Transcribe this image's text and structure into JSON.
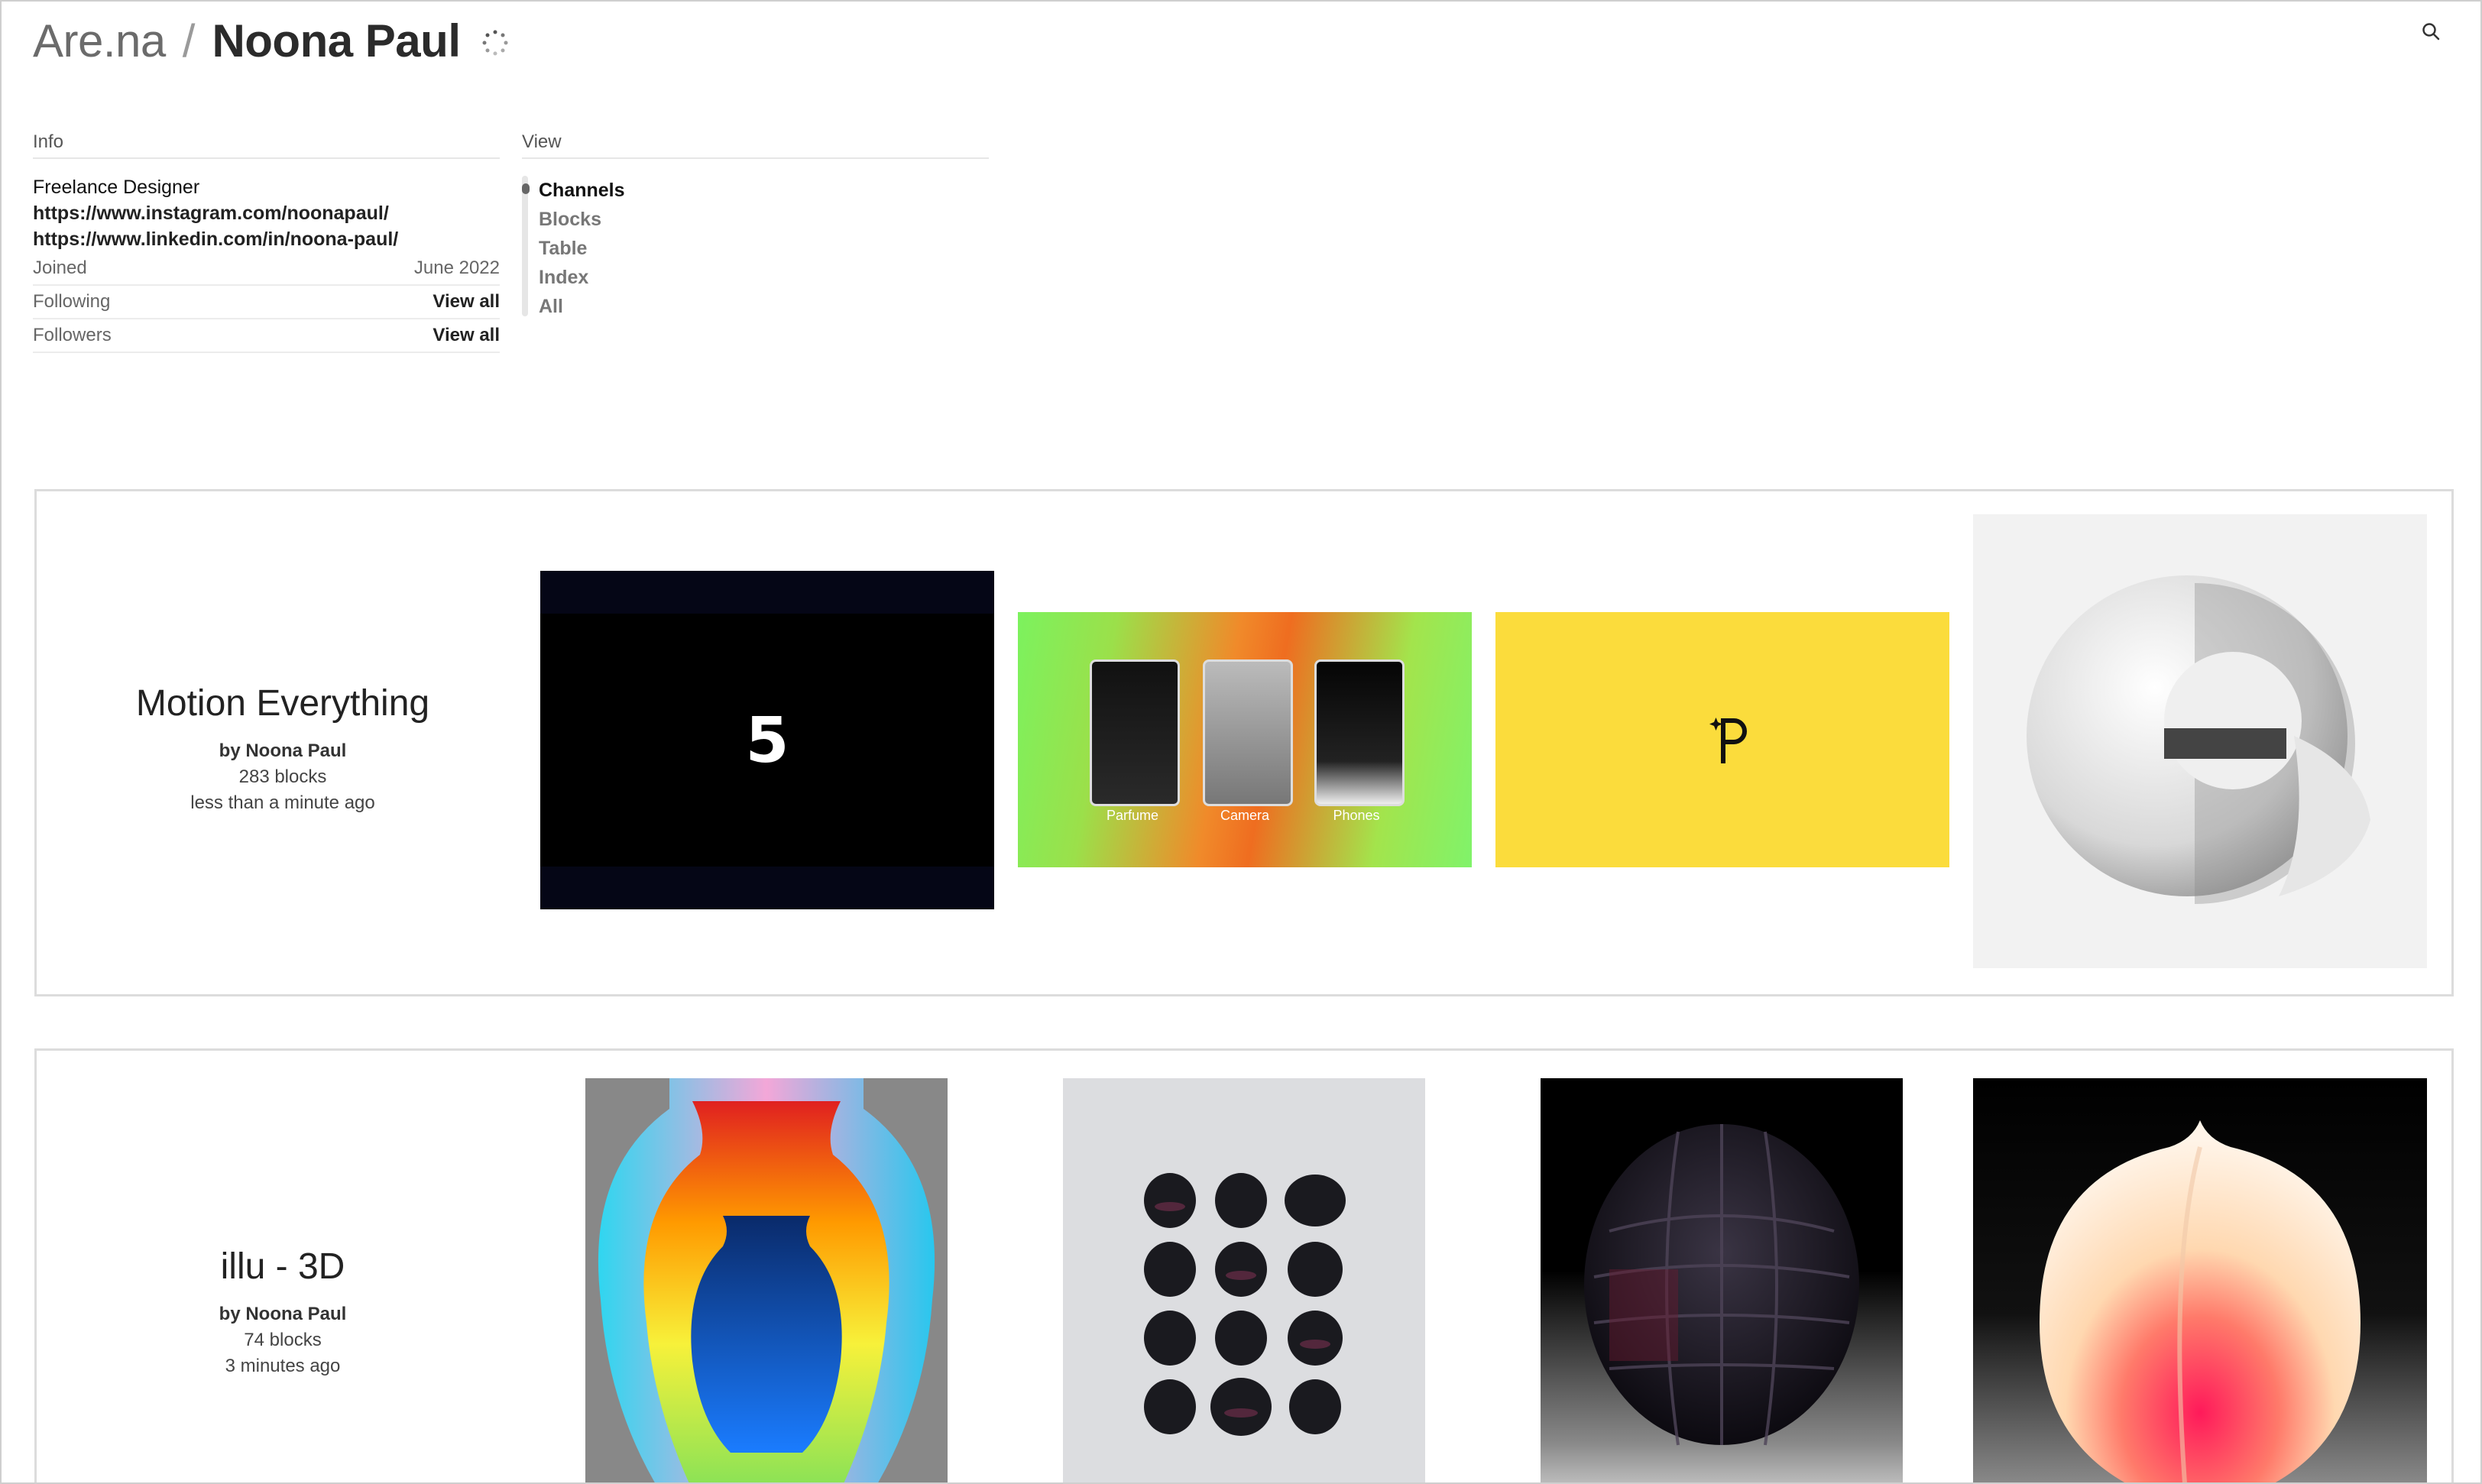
{
  "header": {
    "brand": "Are.na",
    "separator": "/",
    "username": "Noona Paul"
  },
  "info": {
    "label": "Info",
    "bio": "Freelance Designer",
    "links": [
      "https://www.instagram.com/noonapaul/",
      "https://www.linkedin.com/in/noona-paul/"
    ],
    "joined_label": "Joined",
    "joined_value": "June 2022",
    "following_label": "Following",
    "following_link": "View all",
    "followers_label": "Followers",
    "followers_link": "View all"
  },
  "view": {
    "label": "View",
    "items": [
      "Channels",
      "Blocks",
      "Table",
      "Index",
      "All"
    ],
    "active": "Channels"
  },
  "channels": [
    {
      "title": "Motion Everything",
      "author": "by Noona Paul",
      "blocks": "283 blocks",
      "updated": "less than a minute ago",
      "thumbs": [
        "black-numeral-video",
        "phones-gradient-grid",
        "yellow-logo",
        "white-sphere-render"
      ],
      "thumb_labels": [
        "Parfume",
        "Camera",
        "Phones"
      ],
      "numeral": "5"
    },
    {
      "title": "illu - 3D",
      "author": "by Noona Paul",
      "blocks": "74 blocks",
      "updated": "3 minutes ago",
      "thumbs": [
        "rainbow-vase",
        "berry-grid",
        "blackberry-render",
        "peach-render"
      ]
    }
  ],
  "colors": {
    "accent_yellow": "#fbdc3c",
    "border": "#dcdcdc",
    "text_dark": "#222222"
  }
}
